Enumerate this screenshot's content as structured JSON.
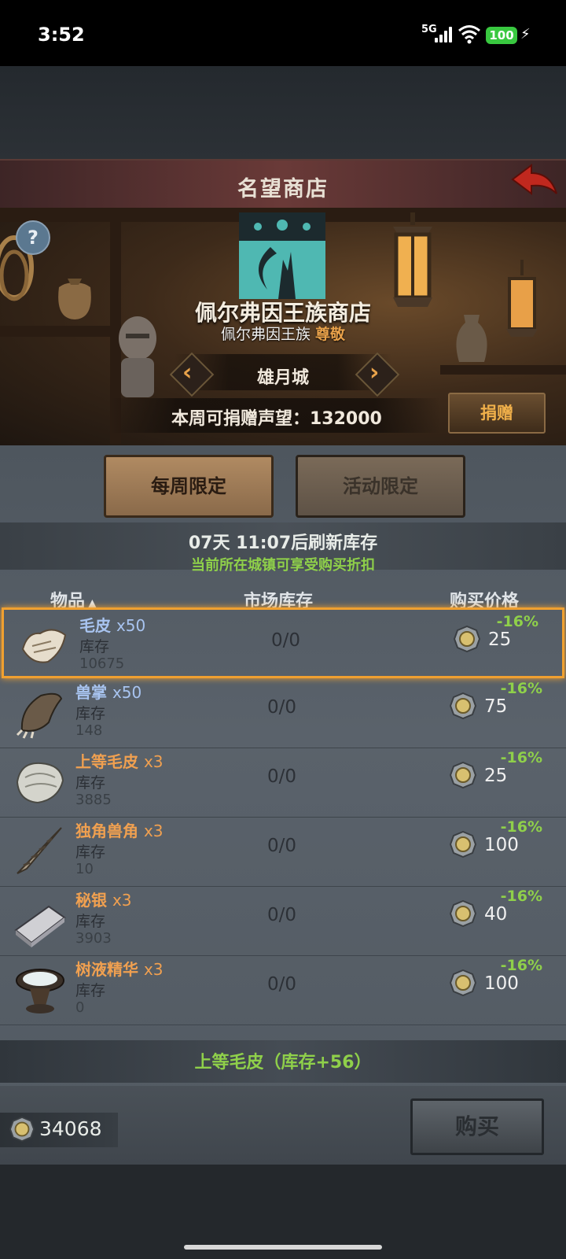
{
  "status": {
    "time": "3:52",
    "network": "5G",
    "battery": "100"
  },
  "header": {
    "title": "名望商店"
  },
  "shop": {
    "name": "佩尔弗因王族商店",
    "faction": "佩尔弗因王族",
    "reputation_level": "尊敬",
    "city": "雄月城",
    "donate_label": "本周可捐赠声望：132000",
    "donate_button": "捐赠"
  },
  "tabs": [
    {
      "label": "每周限定"
    },
    {
      "label": "活动限定"
    }
  ],
  "refresh_text": "07天 11:07后刷新库存",
  "discount_note": "当前所在城镇可享受购买折扣",
  "columns": {
    "item": "物品",
    "sort_indicator": "▲",
    "market": "市场库存",
    "price": "购买价格"
  },
  "inventory_label": "库存",
  "items": [
    {
      "name": "毛皮",
      "qty": "x50",
      "inventory": "10675",
      "market": "0/0",
      "price": "25",
      "discount": "-16%",
      "name_color": "#a8c4f0",
      "icon": "fur-icon"
    },
    {
      "name": "兽掌",
      "qty": "x50",
      "inventory": "148",
      "market": "0/0",
      "price": "75",
      "discount": "-16%",
      "name_color": "#a8c4f0",
      "icon": "beast-paw-icon"
    },
    {
      "name": "上等毛皮",
      "qty": "x3",
      "inventory": "3885",
      "market": "0/0",
      "price": "25",
      "discount": "-16%",
      "name_color": "#f0a050",
      "icon": "fine-fur-icon"
    },
    {
      "name": "独角兽角",
      "qty": "x3",
      "inventory": "10",
      "market": "0/0",
      "price": "100",
      "discount": "-16%",
      "name_color": "#f0a050",
      "icon": "unicorn-horn-icon"
    },
    {
      "name": "秘银",
      "qty": "x3",
      "inventory": "3903",
      "market": "0/0",
      "price": "40",
      "discount": "-16%",
      "name_color": "#f0a050",
      "icon": "mithril-ingot-icon"
    },
    {
      "name": "树液精华",
      "qty": "x3",
      "inventory": "0",
      "market": "0/0",
      "price": "100",
      "discount": "-16%",
      "name_color": "#f0a050",
      "icon": "sap-essence-icon"
    }
  ],
  "notice": "上等毛皮（库存+56）",
  "footer": {
    "money": "34068",
    "buy_button": "购买"
  }
}
